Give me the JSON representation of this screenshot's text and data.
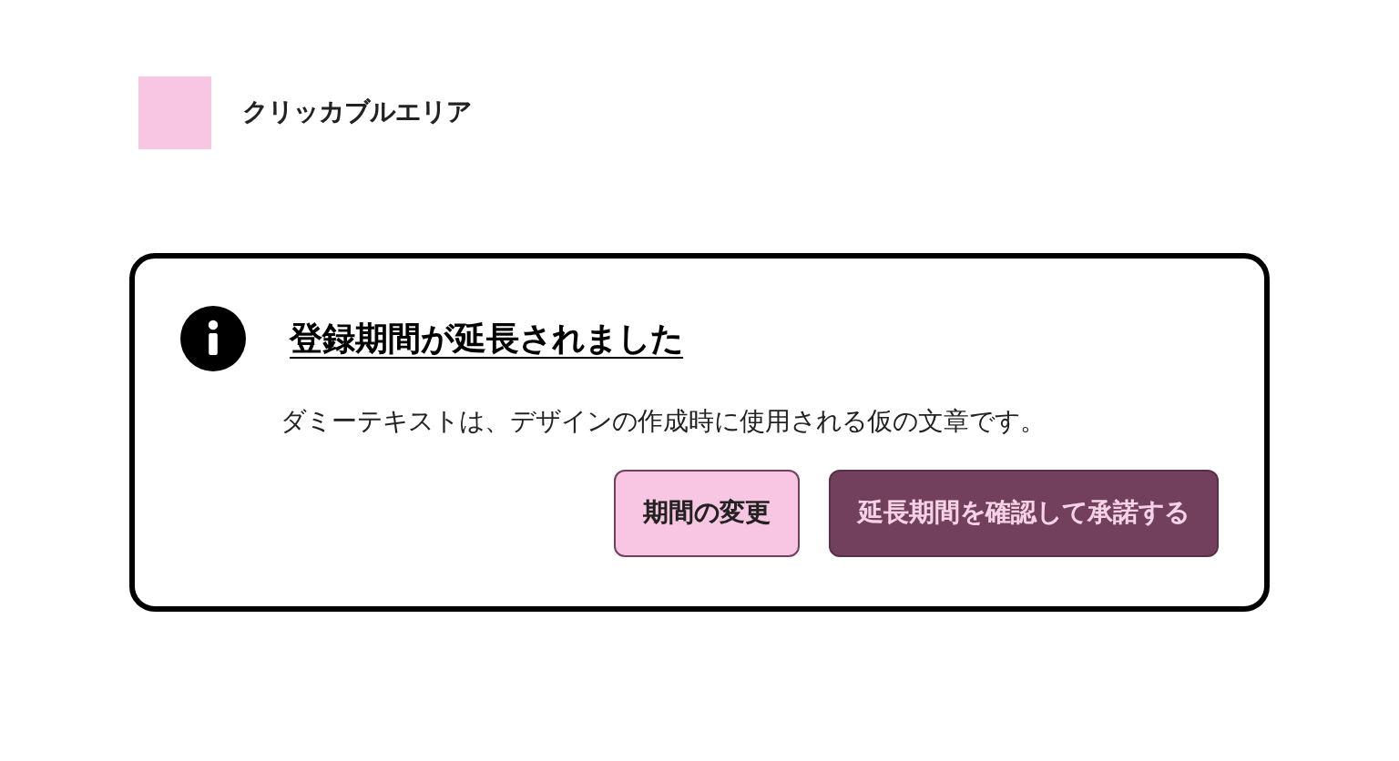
{
  "clickable_area": {
    "label": "クリッカブルエリア"
  },
  "notice": {
    "title": "登録期間が延長されました",
    "message": "ダミーテキストは、デザインの作成時に使用される仮の文章です。",
    "buttons": [
      {
        "label": "期間の変更",
        "kind": "secondary"
      },
      {
        "label": "延長期間を確認して承諾する",
        "kind": "primary"
      }
    ]
  }
}
